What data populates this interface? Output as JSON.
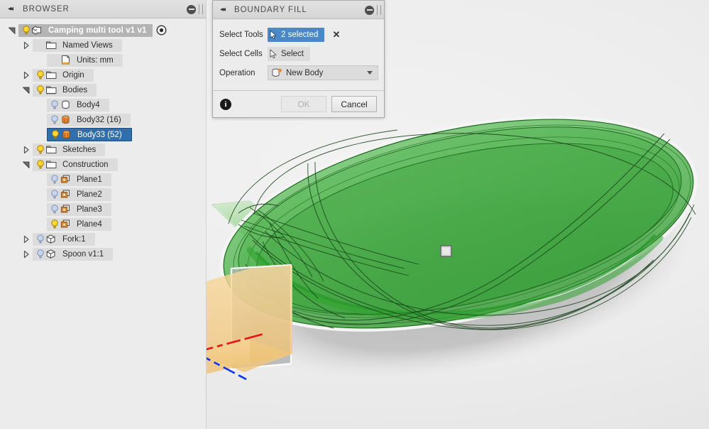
{
  "browser": {
    "title": "BROWSER",
    "collapse_icon": "collapse-left-icon",
    "minimize_icon": "minimize-icon",
    "tree": [
      {
        "label": "Camping multi tool v1 v1",
        "icon": "document-component-icon",
        "indent": 0,
        "twisty": "expanded",
        "bulb": "on",
        "style": "root",
        "eye": "display-setting-icon"
      },
      {
        "label": "Named Views",
        "icon": "folder-icon",
        "indent": 1,
        "twisty": "collapsed",
        "bulb": "none",
        "style": "normal"
      },
      {
        "label": "Units: mm",
        "icon": "units-icon",
        "indent": 2,
        "twisty": "none",
        "bulb": "none",
        "style": "normal"
      },
      {
        "label": "Origin",
        "icon": "folder-icon",
        "indent": 1,
        "twisty": "collapsed",
        "bulb": "on",
        "style": "normal"
      },
      {
        "label": "Bodies",
        "icon": "folder-dashed-icon",
        "indent": 1,
        "twisty": "expanded",
        "bulb": "on",
        "style": "normal"
      },
      {
        "label": "Body4",
        "icon": "body-grey-icon",
        "indent": 2,
        "twisty": "none",
        "bulb": "off",
        "style": "normal"
      },
      {
        "label": "Body32 (16)",
        "icon": "body-orange-icon",
        "indent": 2,
        "twisty": "none",
        "bulb": "off",
        "style": "normal"
      },
      {
        "label": "Body33 (52)",
        "icon": "body-orange-icon",
        "indent": 2,
        "twisty": "none",
        "bulb": "on",
        "style": "selected"
      },
      {
        "label": "Sketches",
        "icon": "folder-icon",
        "indent": 1,
        "twisty": "collapsed",
        "bulb": "on",
        "style": "normal"
      },
      {
        "label": "Construction",
        "icon": "folder-icon",
        "indent": 1,
        "twisty": "expanded",
        "bulb": "on",
        "style": "normal"
      },
      {
        "label": "Plane1",
        "icon": "plane-icon",
        "indent": 2,
        "twisty": "none",
        "bulb": "off",
        "style": "normal"
      },
      {
        "label": "Plane2",
        "icon": "plane-icon",
        "indent": 2,
        "twisty": "none",
        "bulb": "off",
        "style": "normal"
      },
      {
        "label": "Plane3",
        "icon": "plane-icon",
        "indent": 2,
        "twisty": "none",
        "bulb": "off",
        "style": "normal"
      },
      {
        "label": "Plane4",
        "icon": "plane-icon",
        "indent": 2,
        "twisty": "none",
        "bulb": "on",
        "style": "normal"
      },
      {
        "label": "Fork:1",
        "icon": "component-icon",
        "indent": 1,
        "twisty": "collapsed",
        "bulb": "off",
        "style": "normal"
      },
      {
        "label": "Spoon v1:1",
        "icon": "component-icon",
        "indent": 1,
        "twisty": "collapsed",
        "bulb": "off",
        "style": "normal"
      }
    ]
  },
  "dialog": {
    "title": "BOUNDARY FILL",
    "collapse_icon": "collapse-left-icon",
    "minimize_icon": "minimize-icon",
    "fields": {
      "select_tools_label": "Select Tools",
      "select_tools_value": "2 selected",
      "select_tools_clear": "✕",
      "select_cells_label": "Select Cells",
      "select_cells_value": "Select",
      "operation_label": "Operation",
      "operation_value": "New Body"
    },
    "footer": {
      "info_icon": "info-icon",
      "info_glyph": "i",
      "ok_label": "OK",
      "cancel_label": "Cancel"
    }
  },
  "viewport": {
    "body_name": "spoon-bowl-body",
    "body_color": "#4caf50",
    "selection_marker": "selection-handle",
    "origin": {
      "x_axis_color": "#ee1111",
      "y_axis_color": "#00cc22",
      "z_axis_color": "#1133ee",
      "plane_color": "#f5c87a"
    }
  }
}
